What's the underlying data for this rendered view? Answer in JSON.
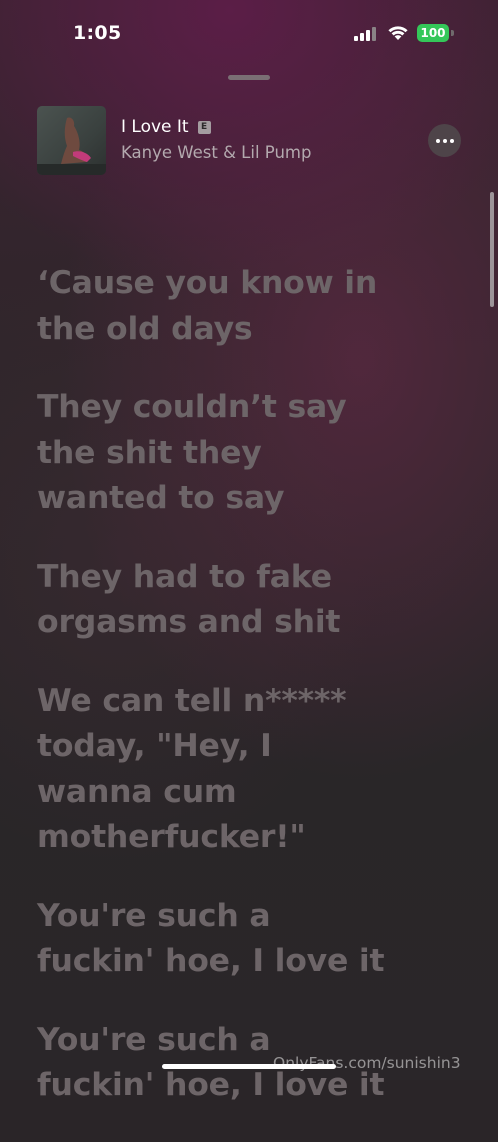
{
  "status_bar": {
    "time": "1:05",
    "battery": "100",
    "battery_color": "#34c759"
  },
  "now_playing": {
    "title": "I Love It",
    "explicit_badge": "E",
    "artist": "Kanye West & Lil Pump"
  },
  "lyrics": [
    "‘Cause you know in the old days",
    "They couldn’t say the shit they wanted to say",
    "They had to fake orgasms and shit",
    "We can tell n***** today, \"Hey, I wanna cum motherfucker!\"",
    "You're such a fuckin' hoe, I love it",
    "You're such a fuckin' hoe, I love it"
  ],
  "watermark": "OnlyFans.com/sunishin3"
}
